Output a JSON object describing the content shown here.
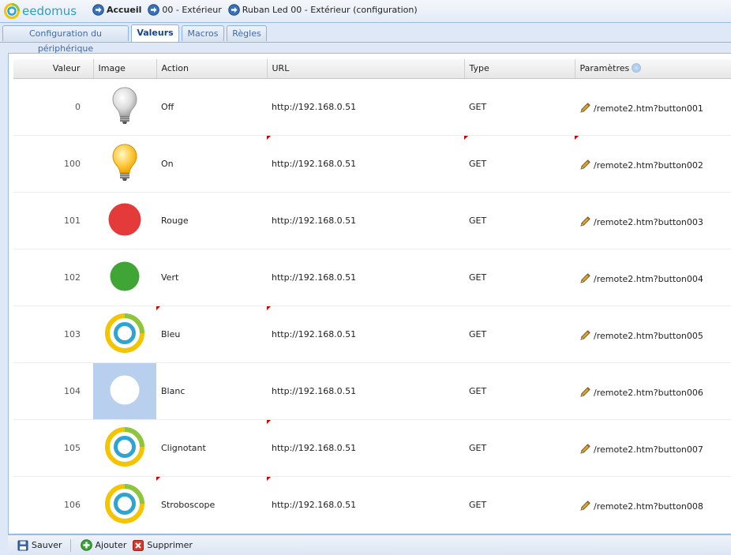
{
  "app": {
    "name": "eedomus"
  },
  "breadcrumb": [
    {
      "label": "Accueil"
    },
    {
      "label": "00 - Extérieur"
    },
    {
      "label": "Ruban Led 00 - Extérieur (configuration)"
    }
  ],
  "tabs": [
    {
      "label": "Configuration du périphérique",
      "active": false
    },
    {
      "label": "Valeurs",
      "active": true
    },
    {
      "label": "Macros",
      "active": false
    },
    {
      "label": "Règles",
      "active": false
    }
  ],
  "grid": {
    "columns": [
      "Valeur",
      "Image",
      "Action",
      "URL",
      "Type",
      "Paramètres"
    ],
    "rows": [
      {
        "valeur": "0",
        "image": "bulb-off-icon",
        "action": "Off",
        "url": "http://192.168.0.51",
        "type": "GET",
        "params": "/remote2.htm?button001"
      },
      {
        "valeur": "100",
        "image": "bulb-on-icon",
        "action": "On",
        "url": "http://192.168.0.51",
        "type": "GET",
        "params": "/remote2.htm?button002"
      },
      {
        "valeur": "101",
        "image": "red-circle-icon",
        "action": "Rouge",
        "url": "http://192.168.0.51",
        "type": "GET",
        "params": "/remote2.htm?button003"
      },
      {
        "valeur": "102",
        "image": "green-circle-icon",
        "action": "Vert",
        "url": "http://192.168.0.51",
        "type": "GET",
        "params": "/remote2.htm?button004"
      },
      {
        "valeur": "103",
        "image": "eedomus-ring-icon",
        "action": "Bleu",
        "url": "http://192.168.0.51",
        "type": "GET",
        "params": "/remote2.htm?button005"
      },
      {
        "valeur": "104",
        "image": "white-circle-icon",
        "action": "Blanc",
        "url": "http://192.168.0.51",
        "type": "GET",
        "params": "/remote2.htm?button006"
      },
      {
        "valeur": "105",
        "image": "eedomus-ring-icon",
        "action": "Clignotant",
        "url": "http://192.168.0.51",
        "type": "GET",
        "params": "/remote2.htm?button007"
      },
      {
        "valeur": "106",
        "image": "eedomus-ring-icon",
        "action": "Stroboscope",
        "url": "http://192.168.0.51",
        "type": "GET",
        "params": "/remote2.htm?button008"
      }
    ]
  },
  "toolbar": {
    "save_label": "Sauver",
    "add_label": "Ajouter",
    "delete_label": "Supprimer"
  },
  "colors": {
    "accent": "#15428b",
    "panel_border": "#99bbe8",
    "selected_cell": "#b8cfee",
    "dirty_marker": "#cc0000",
    "red": "#e53a3a",
    "green": "#3fa535",
    "ring_outer": "#f5c400",
    "ring_inner": "#2fa4d2"
  }
}
